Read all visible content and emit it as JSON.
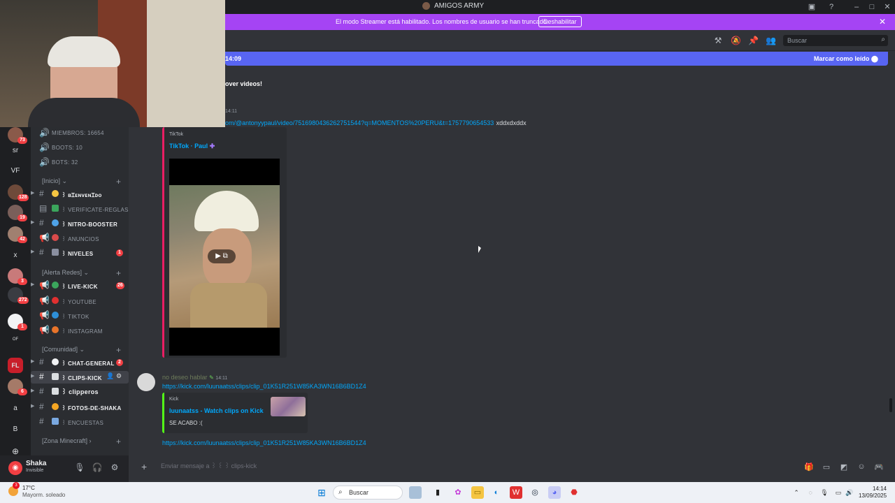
{
  "window": {
    "title": "AMIGOS ARMY"
  },
  "banner": {
    "text": "El modo Streamer está habilitado. Los nombres de usuario se han truncado.",
    "button": "Deshabilitar"
  },
  "header": {
    "search_placeholder": "Buscar"
  },
  "new_messages": {
    "time": "14:09",
    "mark_read": "Marcar como leído"
  },
  "server_rail": {
    "items": [
      {
        "label": "",
        "badge": "73"
      },
      {
        "label": "sr",
        "badge": ""
      },
      {
        "label": "VF",
        "badge": ""
      },
      {
        "label": "",
        "badge": "128"
      },
      {
        "label": "",
        "badge": "19"
      },
      {
        "label": "",
        "badge": "42"
      },
      {
        "label": "x",
        "badge": ""
      },
      {
        "label": "",
        "badge": "3"
      },
      {
        "label": "",
        "badge": "272"
      },
      {
        "label": "",
        "badge": "1"
      },
      {
        "label": "OF",
        "badge": ""
      },
      {
        "label": "FL",
        "badge": ""
      },
      {
        "label": "",
        "badge": "6"
      },
      {
        "label": "a",
        "badge": ""
      },
      {
        "label": "B",
        "badge": ""
      }
    ]
  },
  "stats": {
    "members": "MIEMBROS: 16654",
    "boots": "BOOTS: 10",
    "bots": "BOTS: 32"
  },
  "categories": {
    "inicio": "[Inicio]",
    "alerta": "[Alerta Redes]",
    "comunidad": "[Comunidad]",
    "zona": "[Zona Minecraft]"
  },
  "channels": {
    "bienvenido": {
      "name": "꒱ ʙɪᴇɴᴠᴇɴɪᴅᴏ"
    },
    "verificate": {
      "name": "꒱ verificate-reglas"
    },
    "nitro": {
      "name": "꒱ nitro-booster"
    },
    "anuncios": {
      "name": "꒱ anuncios"
    },
    "niveles": {
      "name": "꒱ niveles",
      "badge": "1"
    },
    "live": {
      "name": "꒱ live-kick",
      "badge": "26"
    },
    "youtube": {
      "name": "꒱ youtube"
    },
    "tiktok": {
      "name": "꒱ tiktok"
    },
    "instagram": {
      "name": "꒱ instagram"
    },
    "chat": {
      "name": "꒱ chat-general",
      "badge": "2"
    },
    "clips": {
      "name": "꒱ clips-kick"
    },
    "clipperos": {
      "name": "꒱ clipperos"
    },
    "fotos": {
      "name": "꒱ fotos-de-shaka"
    },
    "encuestas": {
      "name": "꒱ encuestas"
    }
  },
  "user": {
    "name": "Shaka",
    "status": "Invisible"
  },
  "messages": {
    "m0": {
      "text": "over videos!"
    },
    "m1": {
      "time": "14:11",
      "link": "om/@antonyypaul/video/7516980436262751544?q=MOMENTOS%20PERU&t=1757790654533",
      "extra": "xddxdxddx",
      "embed_provider": "TikTok",
      "embed_title": "TikTok · Paul"
    },
    "m2": {
      "author": "no deseo hablar",
      "time": "14:11",
      "link": "https://kick.com/luunaatss/clips/clip_01K51R251W85KA3WN16B6BD1Z4",
      "embed_provider": "Kick",
      "embed_title": "luunaatss - Watch clips on Kick",
      "embed_desc": "SE ACABO :("
    },
    "m3": {
      "link": "https://kick.com/luunaatss/clips/clip_01K51R251W85KA3WN16B6BD1Z4"
    }
  },
  "composer": {
    "placeholder": "Enviar mensaje a ꒱ ꒰ ꒱ clips-kick"
  },
  "taskbar": {
    "temp": "17°C",
    "weather": "Mayorm. soleado",
    "search": "Buscar",
    "time": "14:14",
    "date": "13/09/2025",
    "notif": "3"
  }
}
